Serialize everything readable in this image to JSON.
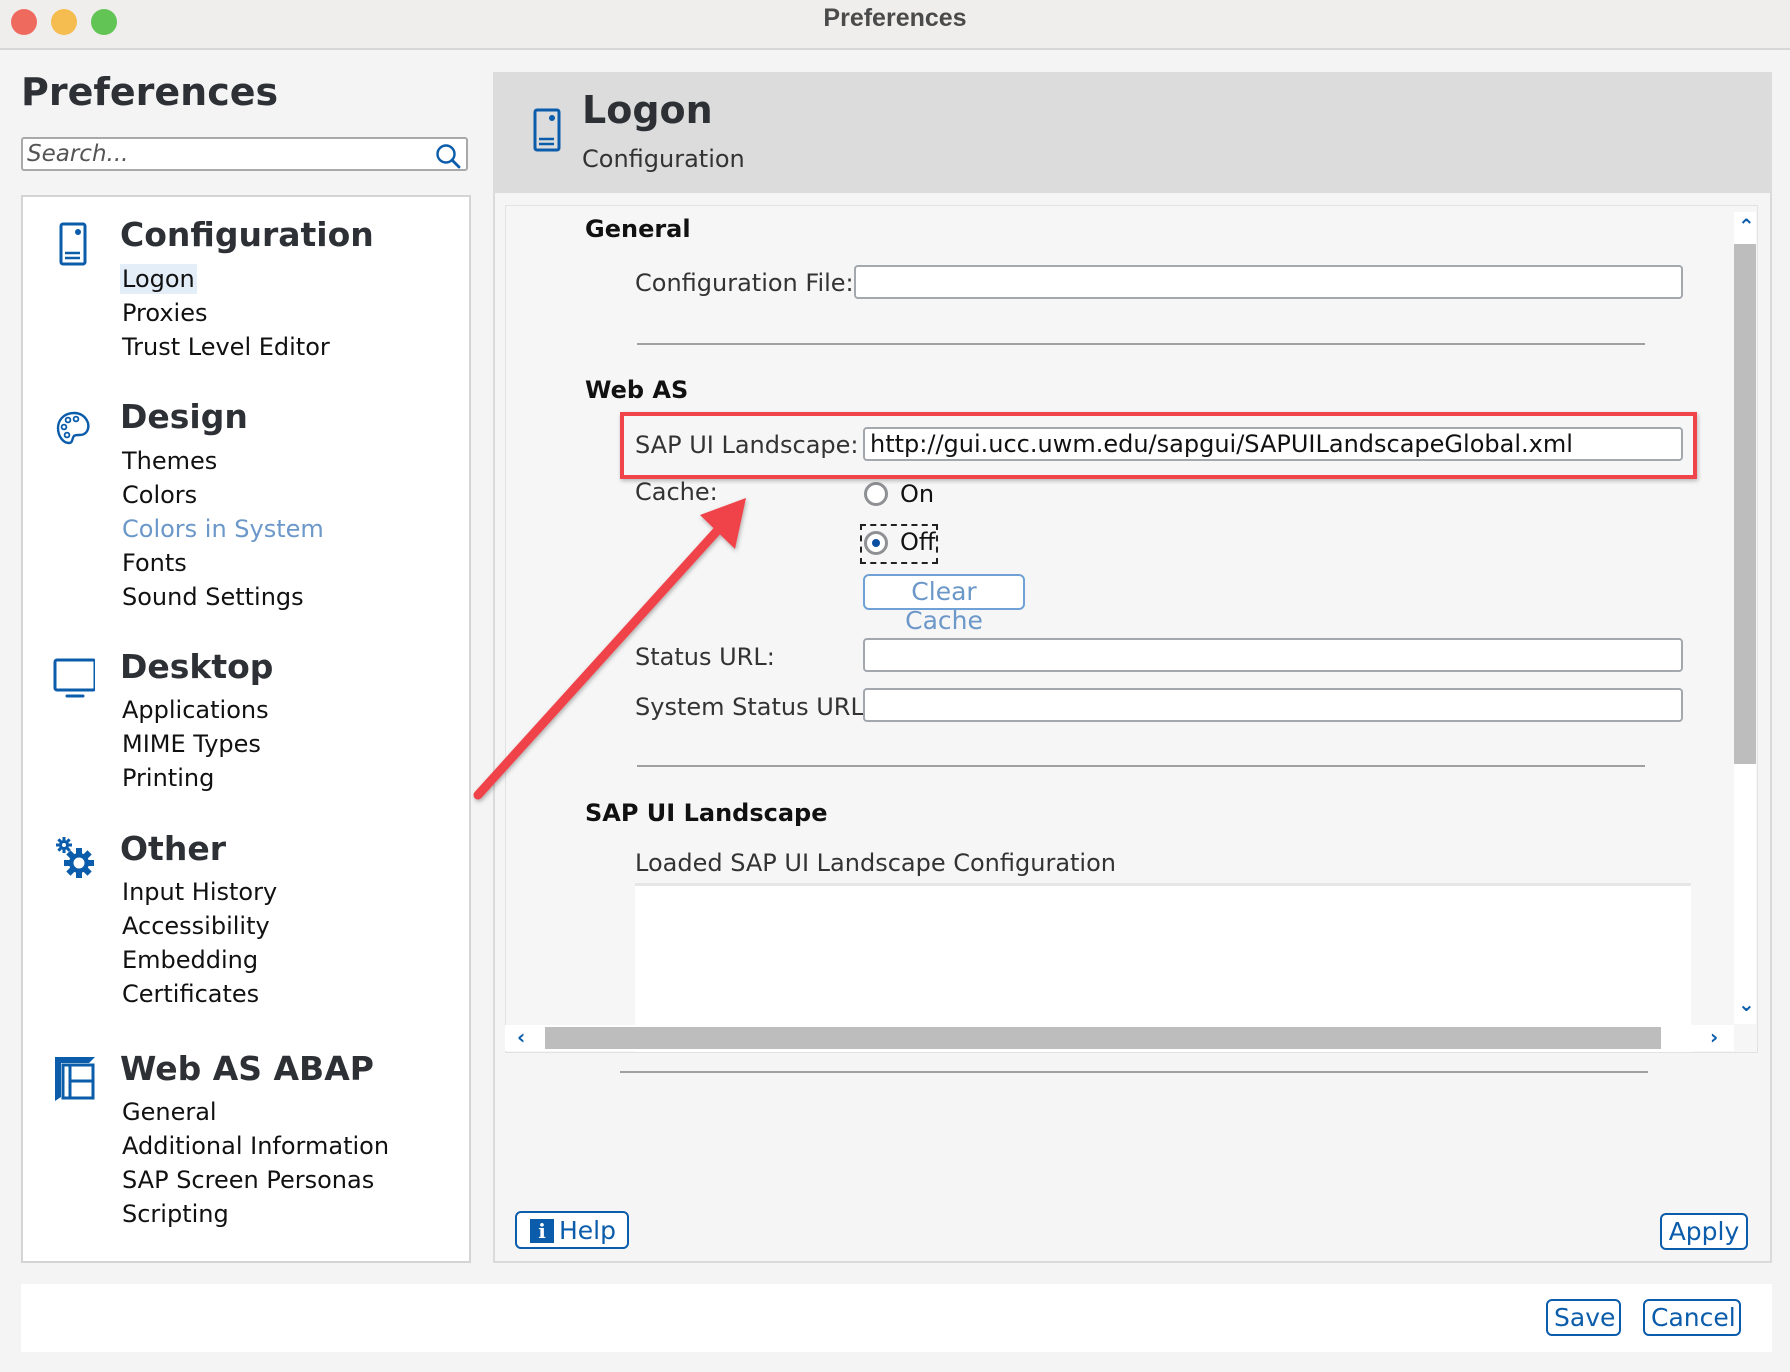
{
  "window": {
    "title": "Preferences",
    "traffic_lights": [
      "close",
      "minimize",
      "zoom"
    ]
  },
  "sidebar": {
    "heading": "Preferences",
    "search": {
      "placeholder": "Search...",
      "value": ""
    },
    "groups": [
      {
        "title": "Configuration",
        "icon": "device-icon",
        "items": [
          {
            "label": "Logon",
            "state": "selected"
          },
          {
            "label": "Proxies"
          },
          {
            "label": "Trust Level Editor"
          }
        ]
      },
      {
        "title": "Design",
        "icon": "palette-icon",
        "items": [
          {
            "label": "Themes"
          },
          {
            "label": "Colors"
          },
          {
            "label": "Colors in System",
            "state": "disabled"
          },
          {
            "label": "Fonts"
          },
          {
            "label": "Sound Settings"
          }
        ]
      },
      {
        "title": "Desktop",
        "icon": "monitor-icon",
        "items": [
          {
            "label": "Applications"
          },
          {
            "label": "MIME Types"
          },
          {
            "label": "Printing"
          }
        ]
      },
      {
        "title": "Other",
        "icon": "gears-icon",
        "items": [
          {
            "label": "Input History"
          },
          {
            "label": "Accessibility"
          },
          {
            "label": "Embedding"
          },
          {
            "label": "Certificates"
          }
        ]
      },
      {
        "title": "Web AS ABAP",
        "icon": "layout-icon",
        "items": [
          {
            "label": "General"
          },
          {
            "label": "Additional Information"
          },
          {
            "label": "SAP Screen Personas"
          },
          {
            "label": "Scripting"
          }
        ]
      }
    ]
  },
  "content": {
    "header": {
      "title": "Logon",
      "subtitle": "Configuration"
    },
    "general": {
      "title": "General",
      "configuration_file_label": "Configuration File:",
      "configuration_file_value": ""
    },
    "webas": {
      "title": "Web AS",
      "landscape_label": "SAP UI Landscape:",
      "landscape_value": "http://gui.ucc.uwm.edu/sapgui/SAPUILandscapeGlobal.xml",
      "cache_label": "Cache:",
      "cache_options": [
        {
          "label": "On",
          "selected": false
        },
        {
          "label": "Off",
          "selected": true
        }
      ],
      "clear_cache_label": "Clear Cache",
      "status_url_label": "Status URL:",
      "status_url_value": "",
      "system_status_url_label": "System Status URL:",
      "system_status_url_value": ""
    },
    "landscape": {
      "title": "SAP UI Landscape",
      "loaded_label": "Loaded SAP UI Landscape Configuration",
      "loaded_value": ""
    },
    "help_label": "Help",
    "apply_label": "Apply"
  },
  "footer": {
    "save_label": "Save",
    "cancel_label": "Cancel"
  },
  "annotation": {
    "color": "#f0434a",
    "highlight_target": "SAP UI Landscape field"
  }
}
